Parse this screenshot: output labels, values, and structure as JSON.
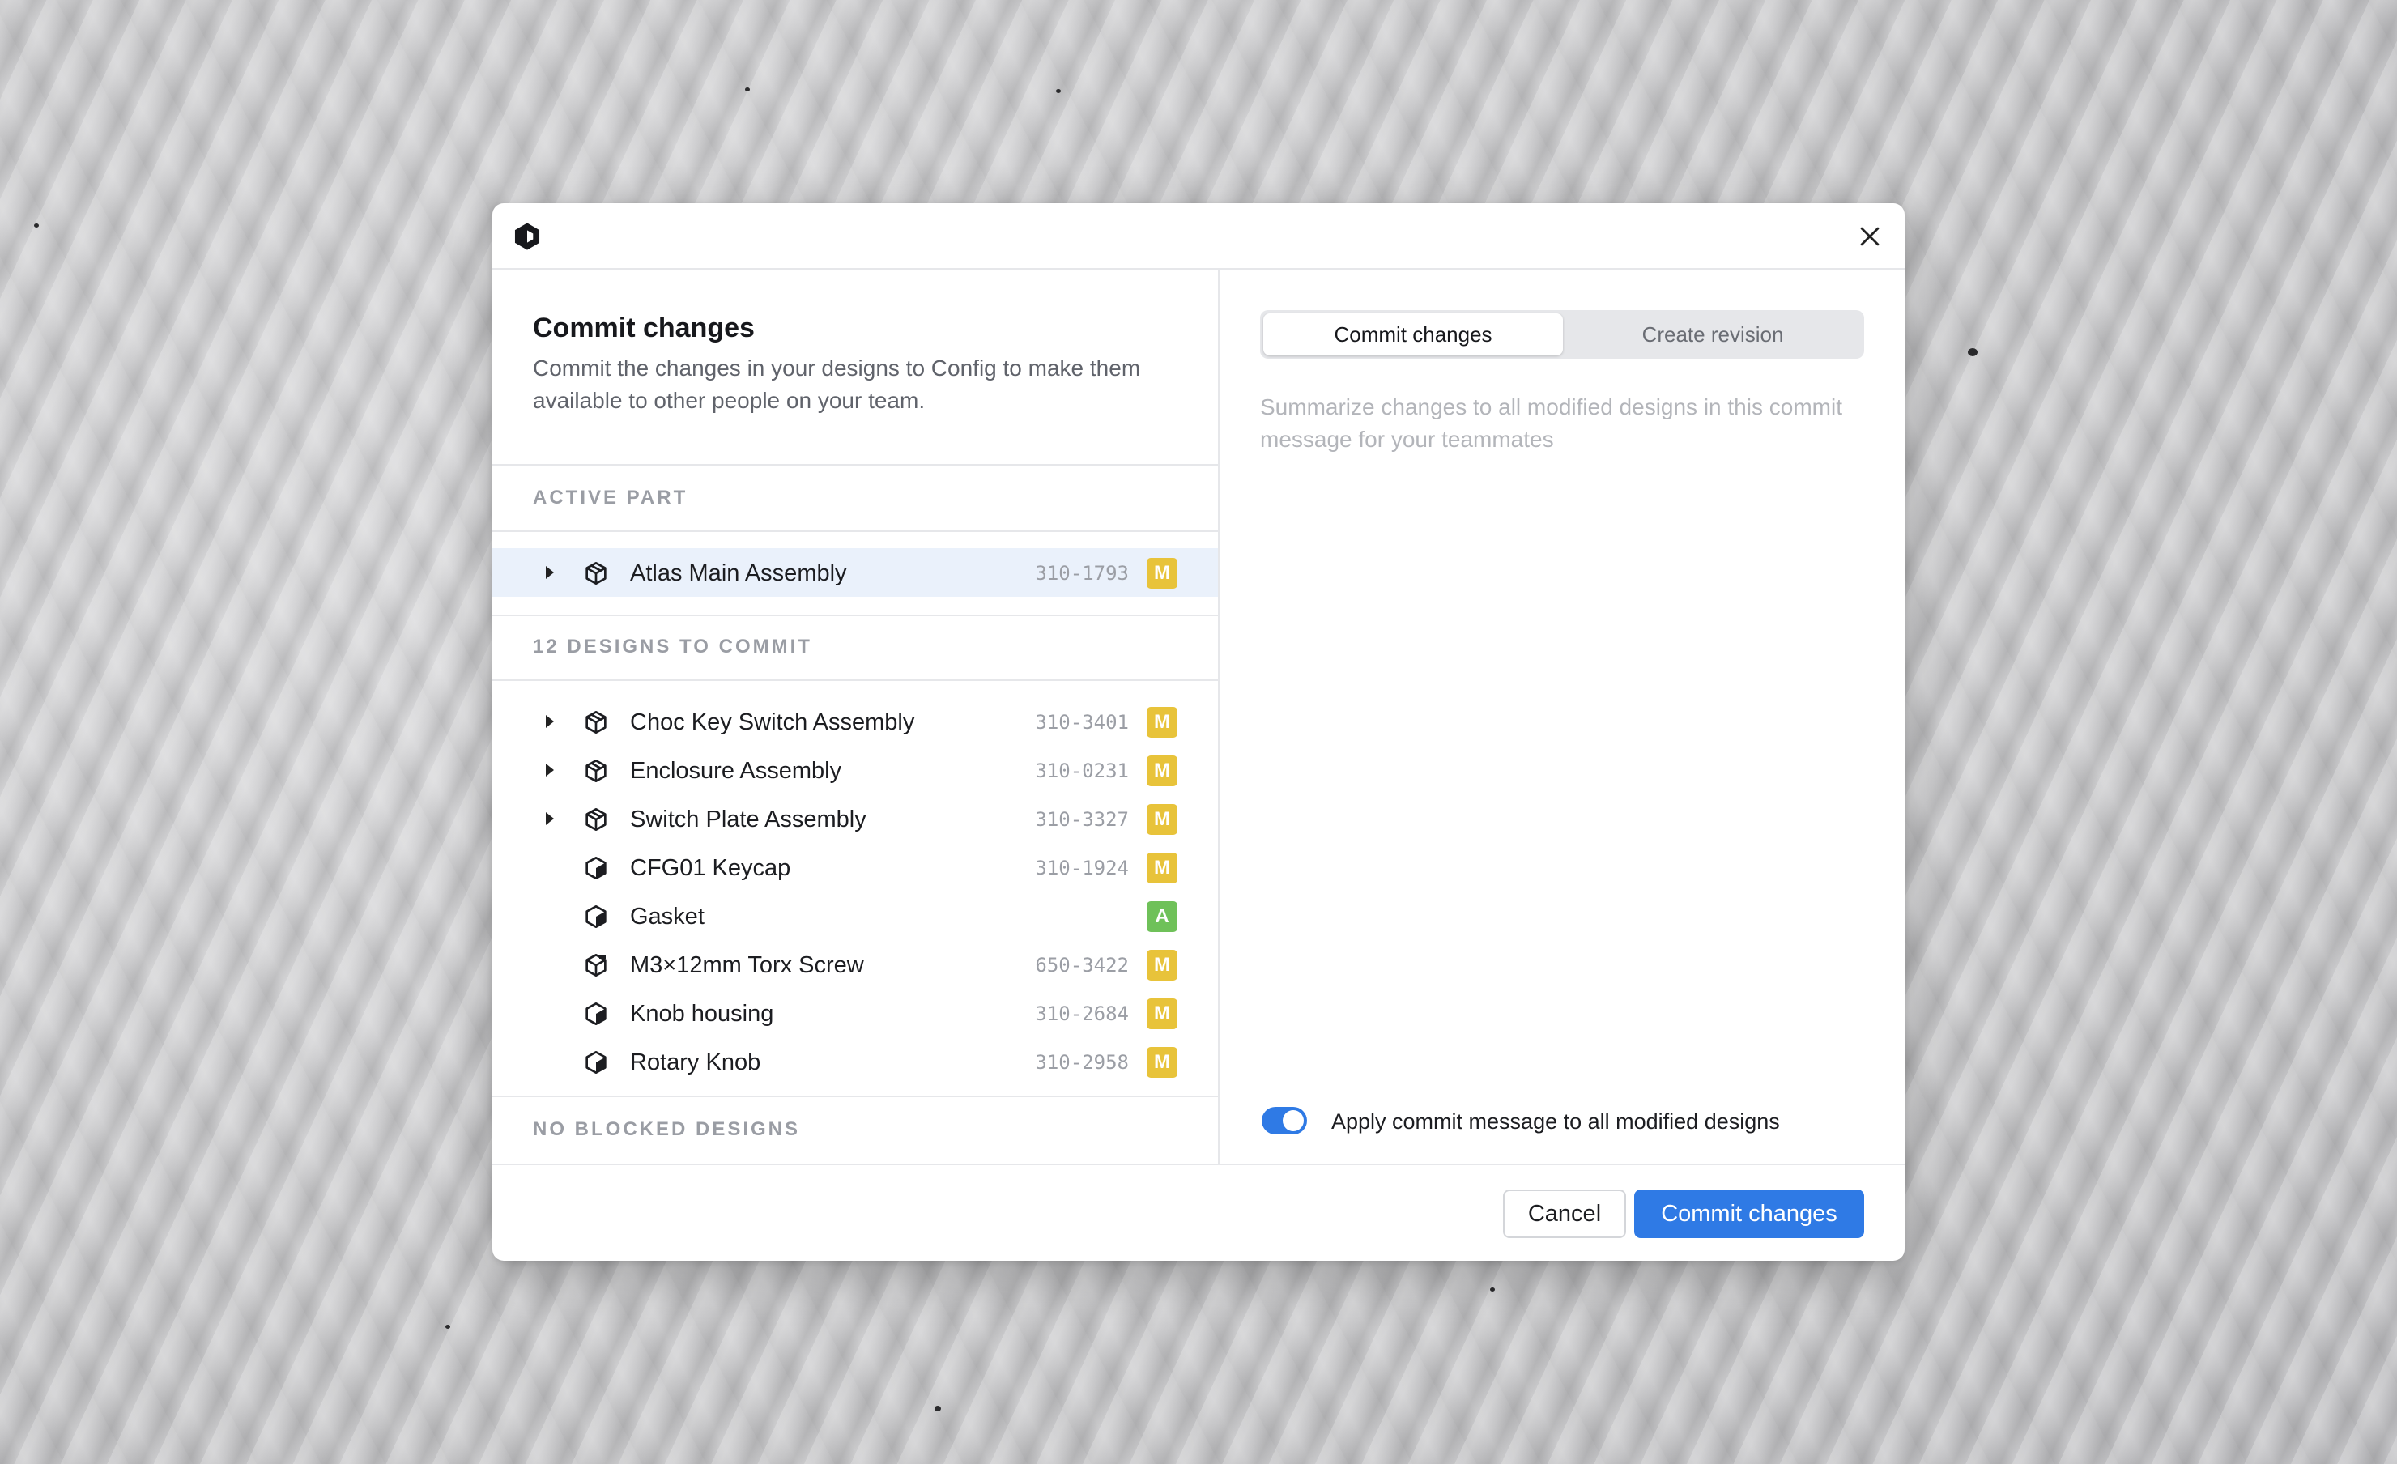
{
  "dialog": {
    "heading": "Commit changes",
    "description": "Commit the changes in your designs to Config to make them available to other people on your team."
  },
  "sections": {
    "active": "ACTIVE PART",
    "to_commit": "12 DESIGNS TO COMMIT",
    "blocked": "NO BLOCKED DESIGNS"
  },
  "active_part": {
    "name": "Atlas Main Assembly",
    "number": "310-1793",
    "status": "M"
  },
  "designs": [
    {
      "name": "Choc Key Switch Assembly",
      "number": "310-3401",
      "status": "M"
    },
    {
      "name": "Enclosure Assembly",
      "number": "310-0231",
      "status": "M"
    },
    {
      "name": "Switch Plate Assembly",
      "number": "310-3327",
      "status": "M"
    },
    {
      "name": "CFG01 Keycap",
      "number": "310-1924",
      "status": "M"
    },
    {
      "name": "Gasket",
      "number": "",
      "status": "A"
    },
    {
      "name": "M3×12mm Torx Screw",
      "number": "650-3422",
      "status": "M"
    },
    {
      "name": "Knob housing",
      "number": "310-2684",
      "status": "M"
    },
    {
      "name": "Rotary Knob",
      "number": "310-2958",
      "status": "M"
    }
  ],
  "tabs": {
    "commit": "Commit changes",
    "revision": "Create revision"
  },
  "message": {
    "placeholder": "Summarize changes to all modified designs in this commit message for your teammates"
  },
  "toggle": {
    "label": "Apply commit message to all modified designs"
  },
  "footer": {
    "cancel": "Cancel",
    "commit": "Commit changes"
  },
  "colors": {
    "accent": "#2f7ae5",
    "modified": "#e8c33a",
    "added": "#6fc159",
    "active_row": "#eaf1fb"
  }
}
